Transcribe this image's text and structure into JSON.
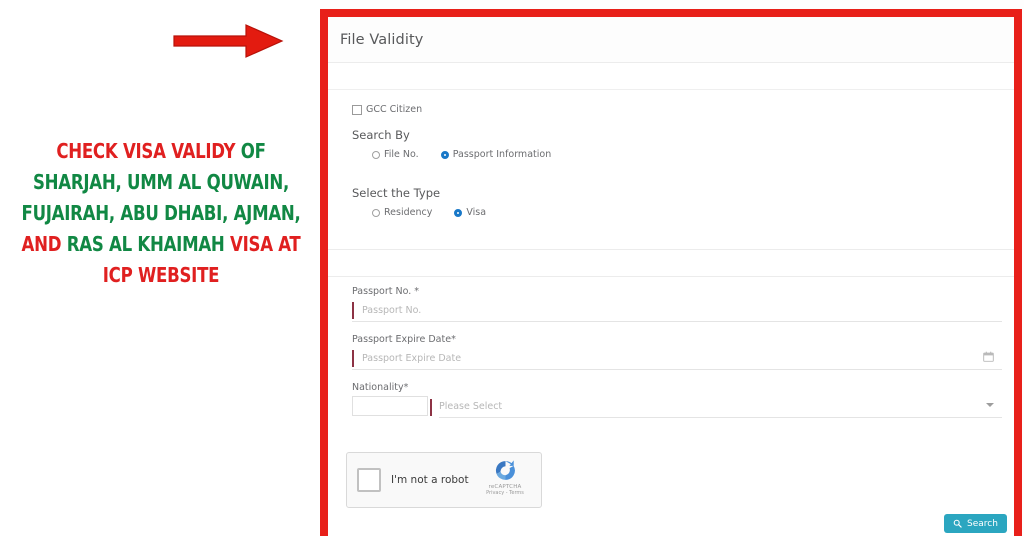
{
  "promo": {
    "arrow_icon": "right-arrow-icon",
    "headline_lines": [
      [
        {
          "text": "CHECK VISA VALIDY ",
          "color": "red"
        },
        {
          "text": "OF",
          "color": "green"
        }
      ],
      [
        {
          "text": "SHARJAH, UMM AL QUWAIN,",
          "color": "green"
        }
      ],
      [
        {
          "text": "FUJAIRAH, ABU DHABI, AJMAN,",
          "color": "green"
        }
      ],
      [
        {
          "text": "AND ",
          "color": "red"
        },
        {
          "text": "RAS AL KHAIMAH ",
          "color": "green"
        },
        {
          "text": "VISA AT",
          "color": "red"
        }
      ],
      [
        {
          "text": "ICP WEBSITE",
          "color": "red"
        }
      ]
    ],
    "colors": {
      "red": "#e02020",
      "green": "#118844"
    }
  },
  "panel": {
    "title": "File Validity",
    "border_color": "#e8201a",
    "gcc_checkbox": {
      "label": "GCC Citizen",
      "checked": false,
      "icon": "checkbox-icon"
    },
    "search_by": {
      "title": "Search By",
      "options": [
        {
          "label": "File No.",
          "selected": false
        },
        {
          "label": "Passport Information",
          "selected": true
        }
      ],
      "selected_color": "#1878c8"
    },
    "select_type": {
      "title": "Select the Type",
      "options": [
        {
          "label": "Residency",
          "selected": false
        },
        {
          "label": "Visa",
          "selected": true
        }
      ]
    },
    "fields": [
      {
        "label": "Passport No. *",
        "placeholder": "Passport No.",
        "value": "",
        "kind": "text",
        "accent_color": "#8d3244"
      },
      {
        "label": "Passport Expire Date*",
        "placeholder": "Passport Expire Date",
        "value": "",
        "kind": "date",
        "icon": "calendar-icon",
        "accent_color": "#8d3244"
      },
      {
        "label": "Nationality*",
        "placeholder": "Please Select",
        "value": "",
        "kind": "select",
        "icon": "chevron-down-icon",
        "accent_color": "#8d3244"
      }
    ],
    "recaptcha": {
      "label": "I'm not a robot",
      "brand_name": "reCAPTCHA",
      "legal": "Privacy - Terms",
      "logo_icon": "recaptcha-logo-icon",
      "checked": false
    },
    "search_button": {
      "label": "Search",
      "icon": "search-icon",
      "color": "#2ba6c0"
    }
  }
}
